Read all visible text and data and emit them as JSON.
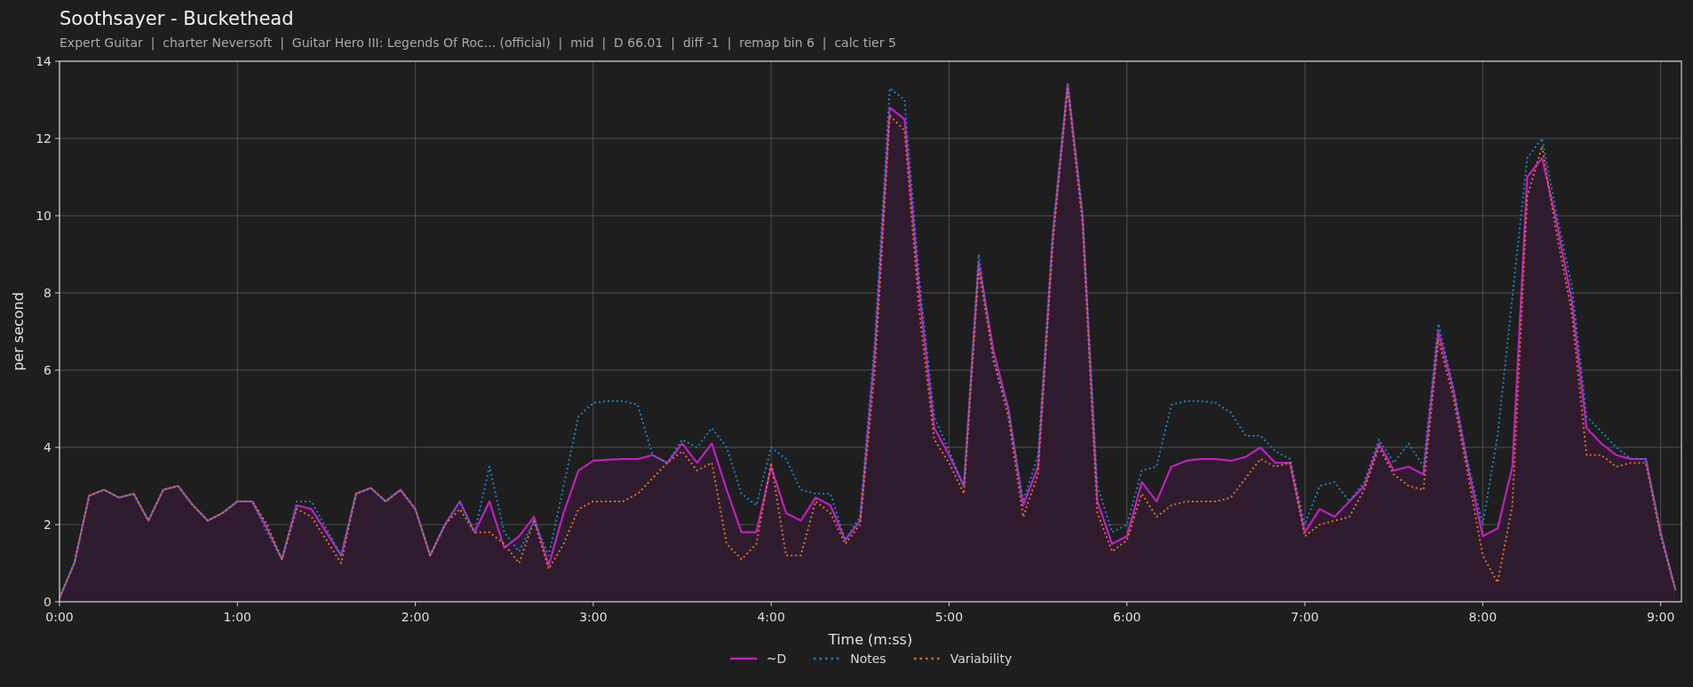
{
  "header": {
    "title": "Soothsayer - Buckethead",
    "subtitle": "Expert Guitar  |  charter Neversoft  |  Guitar Hero III: Legends Of Roc... (official)  |  mid  |  D 66.01  |  diff -1  |  remap bin 6  |  calc tier 5"
  },
  "chart": {
    "chart_data": {
      "type": "line",
      "xlabel": "Time (m:ss)",
      "ylabel": "per second",
      "x": [
        0,
        5,
        10,
        15,
        20,
        25,
        30,
        35,
        40,
        45,
        50,
        55,
        60,
        65,
        70,
        75,
        80,
        85,
        90,
        95,
        100,
        105,
        110,
        115,
        120,
        125,
        130,
        135,
        140,
        145,
        150,
        155,
        160,
        165,
        170,
        175,
        180,
        185,
        190,
        195,
        200,
        205,
        210,
        215,
        220,
        225,
        230,
        235,
        240,
        245,
        250,
        255,
        260,
        265,
        270,
        275,
        280,
        285,
        290,
        295,
        300,
        305,
        310,
        315,
        320,
        325,
        330,
        335,
        340,
        345,
        350,
        355,
        360,
        365,
        370,
        375,
        380,
        385,
        390,
        395,
        400,
        405,
        410,
        415,
        420,
        425,
        430,
        435,
        440,
        445,
        450,
        455,
        460,
        465,
        470,
        475,
        480,
        485,
        490,
        495,
        500,
        505,
        510,
        515,
        520,
        525,
        530,
        535,
        540,
        545
      ],
      "xlim": [
        0,
        547
      ],
      "ylim": [
        0,
        14
      ],
      "xticks": [
        {
          "value": 0,
          "label": "0:00"
        },
        {
          "value": 60,
          "label": "1:00"
        },
        {
          "value": 120,
          "label": "2:00"
        },
        {
          "value": 180,
          "label": "3:00"
        },
        {
          "value": 240,
          "label": "4:00"
        },
        {
          "value": 300,
          "label": "5:00"
        },
        {
          "value": 360,
          "label": "6:00"
        },
        {
          "value": 420,
          "label": "7:00"
        },
        {
          "value": 480,
          "label": "8:00"
        },
        {
          "value": 540,
          "label": "9:00"
        }
      ],
      "yticks": [
        0,
        2,
        4,
        6,
        8,
        10,
        12,
        14
      ],
      "grid": true,
      "series": [
        {
          "name": "~D",
          "color": "#c020c0",
          "type": "area",
          "line_style": "solid",
          "values": [
            0.1,
            1.0,
            2.75,
            2.9,
            2.7,
            2.8,
            2.1,
            2.9,
            3.0,
            2.5,
            2.1,
            2.3,
            2.6,
            2.6,
            1.9,
            1.1,
            2.5,
            2.4,
            1.8,
            1.2,
            2.8,
            2.95,
            2.6,
            2.9,
            2.4,
            1.2,
            2.0,
            2.6,
            1.8,
            2.6,
            1.4,
            1.7,
            2.2,
            0.95,
            2.3,
            3.4,
            3.65,
            3.68,
            3.7,
            3.7,
            3.8,
            3.6,
            4.1,
            3.6,
            4.1,
            2.9,
            1.8,
            1.8,
            3.5,
            2.3,
            2.1,
            2.7,
            2.5,
            1.6,
            2.1,
            6.5,
            12.8,
            12.5,
            8.0,
            4.5,
            3.8,
            3.0,
            8.8,
            6.5,
            5.0,
            2.5,
            3.5,
            9.5,
            13.4,
            10.0,
            2.6,
            1.5,
            1.7,
            3.1,
            2.6,
            3.5,
            3.65,
            3.7,
            3.7,
            3.65,
            3.75,
            4.0,
            3.6,
            3.6,
            1.8,
            2.4,
            2.2,
            2.6,
            3.0,
            4.1,
            3.4,
            3.5,
            3.3,
            7.0,
            5.5,
            3.5,
            1.7,
            1.9,
            3.5,
            11.0,
            11.5,
            9.8,
            7.8,
            4.5,
            4.1,
            3.8,
            3.7,
            3.7,
            1.8,
            0.3
          ]
        },
        {
          "name": "Notes",
          "color": "#1a80c8",
          "type": "line",
          "line_style": "dotted",
          "values": [
            0.1,
            1.0,
            2.75,
            2.9,
            2.7,
            2.8,
            2.1,
            2.9,
            3.0,
            2.5,
            2.1,
            2.3,
            2.6,
            2.6,
            1.8,
            1.1,
            2.6,
            2.6,
            1.9,
            1.2,
            2.8,
            2.95,
            2.6,
            2.9,
            2.4,
            1.2,
            2.0,
            2.6,
            1.8,
            3.5,
            1.8,
            1.3,
            2.1,
            1.2,
            3.0,
            4.8,
            5.15,
            5.2,
            5.2,
            5.1,
            3.8,
            3.6,
            4.2,
            4.0,
            4.5,
            4.0,
            2.8,
            2.5,
            4.0,
            3.7,
            2.9,
            2.8,
            2.8,
            1.6,
            2.2,
            6.8,
            13.3,
            13.0,
            8.3,
            4.8,
            3.9,
            3.0,
            9.0,
            6.2,
            5.0,
            2.6,
            3.8,
            9.6,
            13.45,
            10.1,
            3.0,
            1.8,
            2.0,
            3.4,
            3.5,
            5.1,
            5.2,
            5.2,
            5.15,
            4.9,
            4.3,
            4.3,
            3.9,
            3.7,
            2.0,
            3.0,
            3.1,
            2.6,
            3.1,
            4.2,
            3.6,
            4.1,
            3.5,
            7.2,
            5.6,
            3.6,
            2.0,
            4.3,
            7.9,
            11.5,
            12.0,
            10.0,
            8.2,
            4.8,
            4.4,
            4.0,
            3.7,
            3.7,
            1.8,
            0.3
          ]
        },
        {
          "name": "Variability",
          "color": "#e07020",
          "type": "line",
          "line_style": "dotted",
          "values": [
            0.1,
            1.0,
            2.75,
            2.9,
            2.7,
            2.8,
            2.1,
            2.9,
            3.0,
            2.5,
            2.1,
            2.3,
            2.6,
            2.6,
            2.0,
            1.1,
            2.4,
            2.2,
            1.6,
            1.0,
            2.8,
            2.95,
            2.6,
            2.9,
            2.4,
            1.2,
            2.0,
            2.4,
            1.8,
            1.8,
            1.5,
            1.0,
            2.1,
            0.85,
            1.5,
            2.4,
            2.6,
            2.6,
            2.6,
            2.8,
            3.2,
            3.6,
            3.9,
            3.4,
            3.6,
            1.5,
            1.1,
            1.5,
            3.6,
            1.2,
            1.2,
            2.6,
            2.3,
            1.5,
            2.0,
            6.0,
            12.6,
            12.2,
            7.5,
            4.2,
            3.6,
            2.8,
            8.6,
            6.3,
            4.8,
            2.2,
            3.3,
            9.3,
            13.3,
            9.8,
            2.3,
            1.3,
            1.6,
            2.8,
            2.2,
            2.5,
            2.6,
            2.6,
            2.6,
            2.7,
            3.2,
            3.7,
            3.5,
            3.6,
            1.7,
            2.0,
            2.1,
            2.2,
            2.9,
            4.0,
            3.3,
            3.0,
            2.9,
            6.8,
            5.3,
            3.3,
            1.2,
            0.5,
            2.5,
            10.5,
            11.8,
            9.5,
            7.5,
            3.8,
            3.8,
            3.5,
            3.6,
            3.6,
            1.7,
            0.3
          ]
        }
      ]
    }
  }
}
